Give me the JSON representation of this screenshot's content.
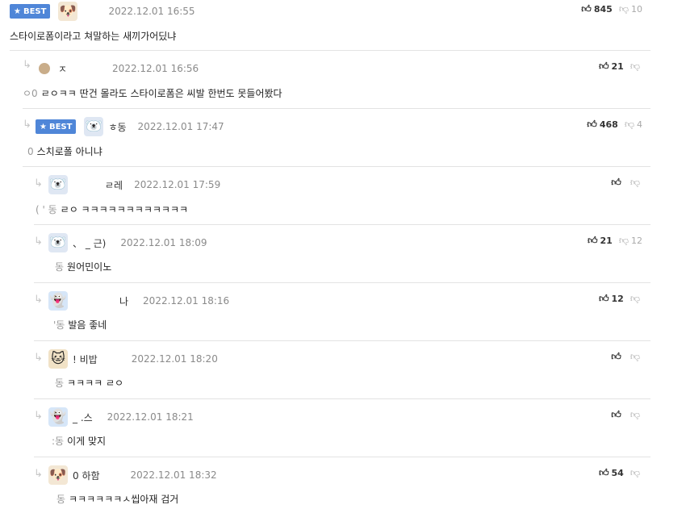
{
  "badge_label": "BEST",
  "comments": [
    {
      "nick": "",
      "time": "2022.12.01 16:55",
      "up": "845",
      "down": "10",
      "mention": "",
      "text": "스타이로폼이라고 쳐말하는 새끼가어딨냐",
      "avatar": "dog-icon",
      "best": true
    },
    {
      "nick": "ㅈ",
      "time": "2022.12.01 16:56",
      "up": "21",
      "down": "",
      "mention": "ㅇ0",
      "text": "ㄹㅇㅋㅋ 딴건 몰라도 스타이로폼은 씨발 한번도 못들어봤다",
      "avatar": "dot-icon",
      "best": false
    },
    {
      "nick": "ㅎ동",
      "time": "2022.12.01 17:47",
      "up": "468",
      "down": "4",
      "mention": "0",
      "text": "스치로폴 아니냐",
      "avatar": "bear-icon",
      "best": true
    },
    {
      "nick": "ㄹ레",
      "time": "2022.12.01 17:59",
      "up": "",
      "down": "",
      "mention": "( ' 동",
      "text": "ㄹㅇ ㅋㅋㅋㅋㅋㅋㅋㅋㅋㅋㅋㅋ",
      "avatar": "bear-icon",
      "best": false
    },
    {
      "nick": "、 _ 근)",
      "time": "2022.12.01 18:09",
      "up": "21",
      "down": "12",
      "mention": "동",
      "text": "원어민이노",
      "avatar": "bear-icon",
      "best": false
    },
    {
      "nick": "나",
      "time": "2022.12.01 18:16",
      "up": "12",
      "down": "",
      "mention": "'동",
      "text": "발음 좋네",
      "avatar": "ghost-icon",
      "best": false
    },
    {
      "nick": "!  비밥",
      "time": "2022.12.01 18:20",
      "up": "",
      "down": "",
      "mention": "동",
      "text": "ㅋㅋㅋㅋ ㄹㅇ",
      "avatar": "cat-icon",
      "best": false
    },
    {
      "nick": "_ .스",
      "time": "2022.12.01 18:21",
      "up": "",
      "down": "",
      "mention": ":동",
      "text": "이게 맞지",
      "avatar": "ghost-icon",
      "best": false
    },
    {
      "nick": "0  하함",
      "time": "2022.12.01 18:32",
      "up": "54",
      "down": "",
      "mention": "동",
      "text": "ㅋㅋㅋㅋㅋㅋㅅ씹아재 검거",
      "avatar": "dog-icon",
      "best": false
    }
  ]
}
